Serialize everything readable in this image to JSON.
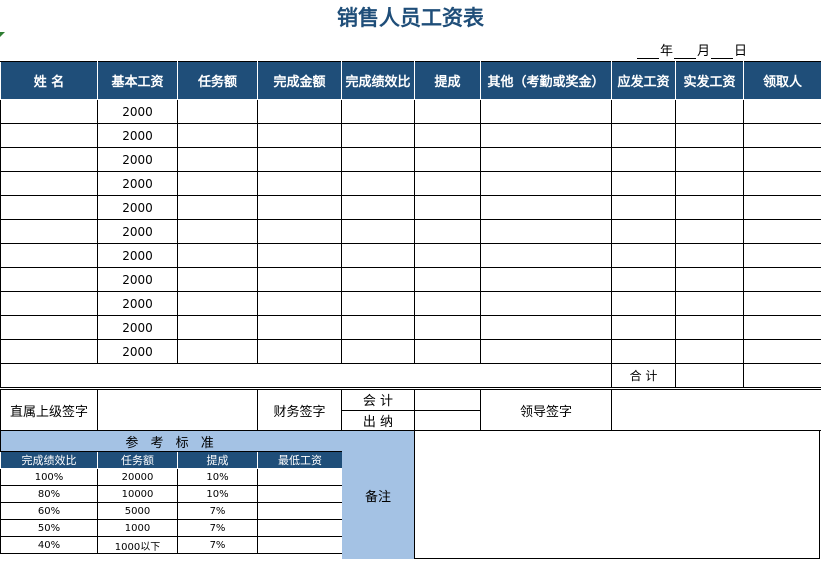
{
  "title": "销售人员工资表",
  "date": {
    "year": "年",
    "month": "月",
    "day": "日"
  },
  "headers": [
    "姓  名",
    "基本工资",
    "任务额",
    "完成金额",
    "完成绩效比",
    "提成",
    "其他（考勤或奖金）",
    "应发工资",
    "实发工资",
    "领取人"
  ],
  "rows": [
    "2000",
    "2000",
    "2000",
    "2000",
    "2000",
    "2000",
    "2000",
    "2000",
    "2000",
    "2000",
    "2000"
  ],
  "total_label": "合  计",
  "signatures": {
    "supervisor": "直属上级签字",
    "finance": "财务签字",
    "accountant": "会  计",
    "cashier": "出  纳",
    "leader": "领导签字"
  },
  "reference": {
    "title": "参 考 标 准",
    "headers": [
      "完成绩效比",
      "任务额",
      "提成",
      "最低工资"
    ],
    "rows": [
      [
        "100%",
        "20000",
        "10%",
        ""
      ],
      [
        "80%",
        "10000",
        "10%",
        ""
      ],
      [
        "60%",
        "5000",
        "7%",
        ""
      ],
      [
        "50%",
        "1000",
        "7%",
        ""
      ],
      [
        "40%",
        "1000以下",
        "7%",
        ""
      ]
    ]
  },
  "note_label": "备注"
}
